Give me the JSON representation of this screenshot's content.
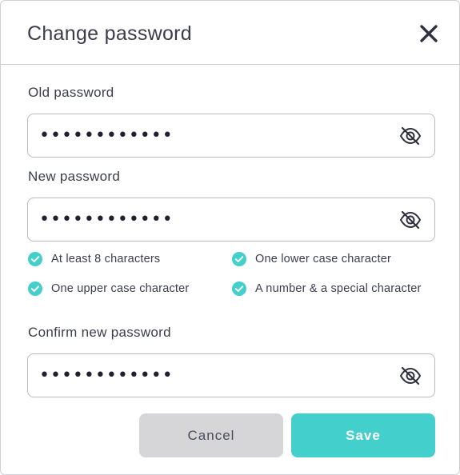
{
  "dialog": {
    "title": "Change password"
  },
  "old_password": {
    "label": "Old password",
    "value": "••••••••••••"
  },
  "new_password": {
    "label": "New password",
    "value": "••••••••••••"
  },
  "requirements": [
    {
      "label": "At least 8 characters",
      "met": true
    },
    {
      "label": "One lower case character",
      "met": true
    },
    {
      "label": "One upper case character",
      "met": true
    },
    {
      "label": "A number & a special character",
      "met": true
    }
  ],
  "confirm_password": {
    "label": "Confirm new password",
    "value": "••••••••••••"
  },
  "actions": {
    "cancel_label": "Cancel",
    "save_label": "Save"
  },
  "colors": {
    "accent": "#43cfcc",
    "text": "#3b3d4c",
    "cancel_bg": "#d6d6d9"
  },
  "icons": {
    "close": "close-icon",
    "visibility": "eye-off-icon",
    "requirement": "check-circle-icon"
  }
}
